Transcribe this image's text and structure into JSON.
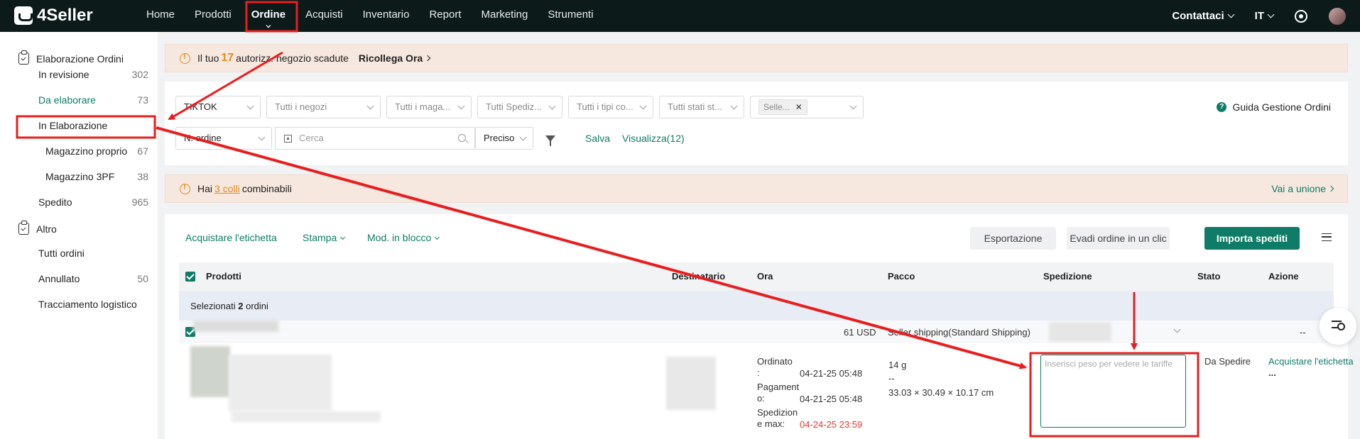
{
  "brand": "4Seller",
  "nav": [
    "Home",
    "Prodotti",
    "Ordine",
    "Acquisti",
    "Inventario",
    "Report",
    "Marketing",
    "Strumenti"
  ],
  "top_right": {
    "contact": "Contattaci",
    "lang": "IT"
  },
  "sidebar": {
    "group1": "Elaborazione Ordini",
    "items": [
      {
        "label": "In revisione",
        "count": "302"
      },
      {
        "label": "Da elaborare",
        "count": "73"
      },
      {
        "label": "In Elaborazione",
        "count": ""
      },
      {
        "label": "Magazzino proprio",
        "count": "67"
      },
      {
        "label": "Magazzino 3PF",
        "count": "38"
      },
      {
        "label": "Spedito",
        "count": "965"
      }
    ],
    "group2": "Altro",
    "items2": [
      {
        "label": "Tutti ordini",
        "count": ""
      },
      {
        "label": "Annullato",
        "count": "50"
      },
      {
        "label": "Tracciamento logistico",
        "count": ""
      }
    ]
  },
  "alert1": {
    "pre": "Il tuo",
    "num": "17",
    "post": "autorizz. negozio scadute",
    "action": "Ricollega Ora"
  },
  "filters": {
    "row1": [
      "TIKTOK",
      "Tutti i negozi",
      "Tutti i maga...",
      "Tutti Spediz...",
      "Tutti i tipi co...",
      "Tutti stati st..."
    ],
    "tag": "Selle...",
    "field": "N. ordine",
    "search_placeholder": "Cerca",
    "match": "Preciso",
    "save": "Salva",
    "view": "Visualizza(12)",
    "help": "Guida Gestione Ordini"
  },
  "alert2": {
    "pre": "Hai",
    "link": "3 colli",
    "post": "combinabili",
    "action": "Vai a unione"
  },
  "toolbar": {
    "buy_label": "Acquistare l'etichetta",
    "print": "Stampa",
    "bulk": "Mod. in blocco",
    "export": "Esportazione",
    "fulfill": "Evadi ordine in un clic",
    "import": "Importa spediti"
  },
  "table": {
    "headers": [
      "Prodotti",
      "Destinatario",
      "Ora",
      "Pacco",
      "Spedizione",
      "Stato",
      "Azione"
    ],
    "selected_pre": "Selezionati",
    "selected_num": "2",
    "selected_post": "ordini",
    "row": {
      "amount": "61 USD",
      "shipping_method": "Seller shipping(Standard Shipping)",
      "dash": "--",
      "ordered_label": "Ordinato\n:",
      "ordered": "04-21-25 05:48",
      "paid_label": "Pagament\no:",
      "paid": "04-21-25 05:48",
      "ship_max_label": "Spedizion\ne max:",
      "ship_max": "04-24-25 23:59",
      "weight": "14 g",
      "weight_dash": "--",
      "dims": "33.03 × 30.49 × 10.17 cm",
      "ship_placeholder": "Inserisci peso per vedere le tariffe",
      "status": "Da Spedire",
      "action": "Acquistare l'etichetta",
      "more": "..."
    }
  },
  "colors": {
    "accent": "#0e7c66",
    "annotation": "#e81e1e",
    "warning": "#e58a1f"
  }
}
